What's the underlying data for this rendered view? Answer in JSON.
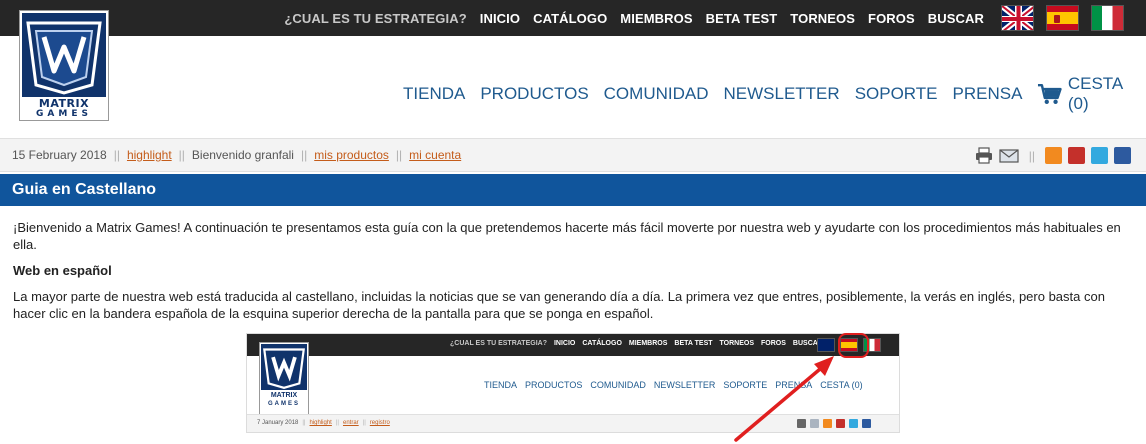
{
  "top_nav": {
    "items": [
      "¿CUAL ES TU ESTRATEGIA?",
      "INICIO",
      "CATÁLOGO",
      "MIEMBROS",
      "BETA TEST",
      "TORNEOS",
      "FOROS",
      "BUSCAR"
    ],
    "flags": [
      "uk-flag-icon",
      "spain-flag-icon",
      "italy-flag-icon"
    ]
  },
  "logo": {
    "line1": "MATRIX",
    "line2": "GAMES"
  },
  "main_nav": {
    "items": [
      "TIENDA",
      "PRODUCTOS",
      "COMUNIDAD",
      "NEWSLETTER",
      "SOPORTE",
      "PRENSA"
    ],
    "cart": "CESTA (0)"
  },
  "strip": {
    "date": "15 February 2018",
    "highlight": "highlight",
    "welcome": "Bienvenido granfali",
    "my_products": "mis productos",
    "my_account": "mi cuenta",
    "separator": "||"
  },
  "page": {
    "title": "Guia en Castellano",
    "intro": "¡Bienvenido a Matrix Games! A continuación te presentamos esta guía con la que pretendemos hacerte más fácil moverte por nuestra web y ayudarte con los procedimientos más habituales en ella.",
    "section_title": "Web en español",
    "section_body": "La mayor parte de nuestra web está traducida al castellano, incluidas la noticias que se van generando día a día. La primera vez que entres, posiblemente, la verás en inglés, pero basta con hacer clic en la bandera española de la esquina superior derecha de la pantalla para que se ponga en español."
  },
  "embedded_screenshot": {
    "top_nav": [
      "¿CUAL ES TU ESTRATEGIA?",
      "INICIO",
      "CATÁLOGO",
      "MIEMBROS",
      "BETA TEST",
      "TORNEOS",
      "FOROS",
      "BUSCAR"
    ],
    "main_nav": [
      "TIENDA",
      "PRODUCTOS",
      "COMUNIDAD",
      "NEWSLETTER",
      "SOPORTE",
      "PRENSA"
    ],
    "cart": "CESTA (0)",
    "date": "7 January 2018",
    "highlight": "highlight",
    "enter": "entrar",
    "register": "registro",
    "logo_line1": "MATRIX",
    "logo_line2": "GAMES"
  },
  "colors": {
    "topbar": "#262626",
    "brand_blue": "#10559c",
    "nav_blue": "#1f5a8e",
    "link_orange": "#c45c1a",
    "annotation_red": "#e01f1f"
  },
  "tools_icons": [
    "print-icon",
    "email-icon",
    "rss-icon",
    "youtube-icon",
    "twitter-icon",
    "facebook-icon"
  ]
}
